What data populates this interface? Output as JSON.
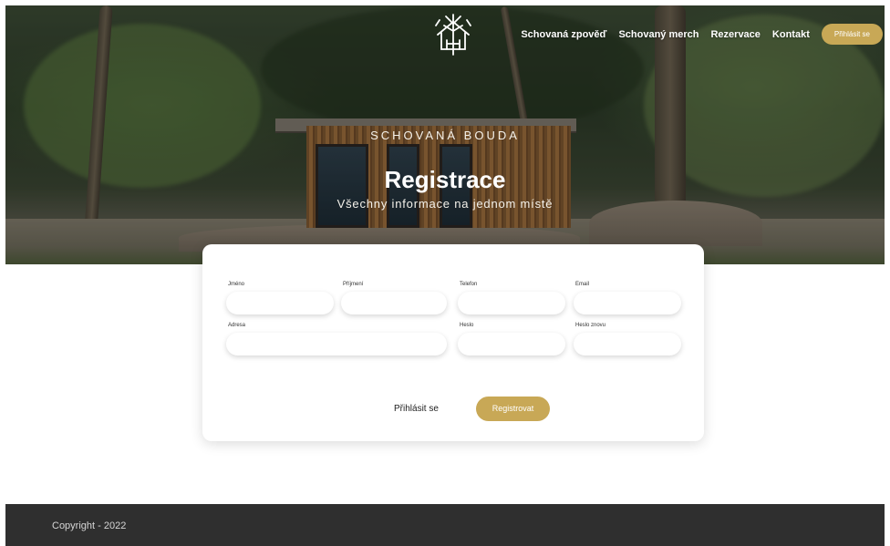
{
  "nav": {
    "links": [
      "Schovaná zpověď",
      "Schovaný merch",
      "Rezervace",
      "Kontakt"
    ],
    "login_button": "Přihlásit se"
  },
  "hero": {
    "subtitle": "SCHOVANÁ BOUDA",
    "title": "Registrace",
    "tagline": "Všechny informace na jednom místě"
  },
  "form": {
    "fields": {
      "first_name": {
        "label": "Jméno",
        "value": ""
      },
      "last_name": {
        "label": "Příjmení",
        "value": ""
      },
      "phone": {
        "label": "Telefon",
        "value": ""
      },
      "email": {
        "label": "Email",
        "value": ""
      },
      "address": {
        "label": "Adresa",
        "value": ""
      },
      "password": {
        "label": "Heslo",
        "value": ""
      },
      "password_again": {
        "label": "Heslo znovu",
        "value": ""
      }
    },
    "login_link": "Přihlásit se",
    "submit": "Registrovat"
  },
  "footer": {
    "copyright": "Copyright - 2022"
  },
  "colors": {
    "accent": "#c8a856",
    "footer_bg": "#2f2f2f"
  },
  "icons": {
    "logo": "tree-house-logo-icon"
  }
}
